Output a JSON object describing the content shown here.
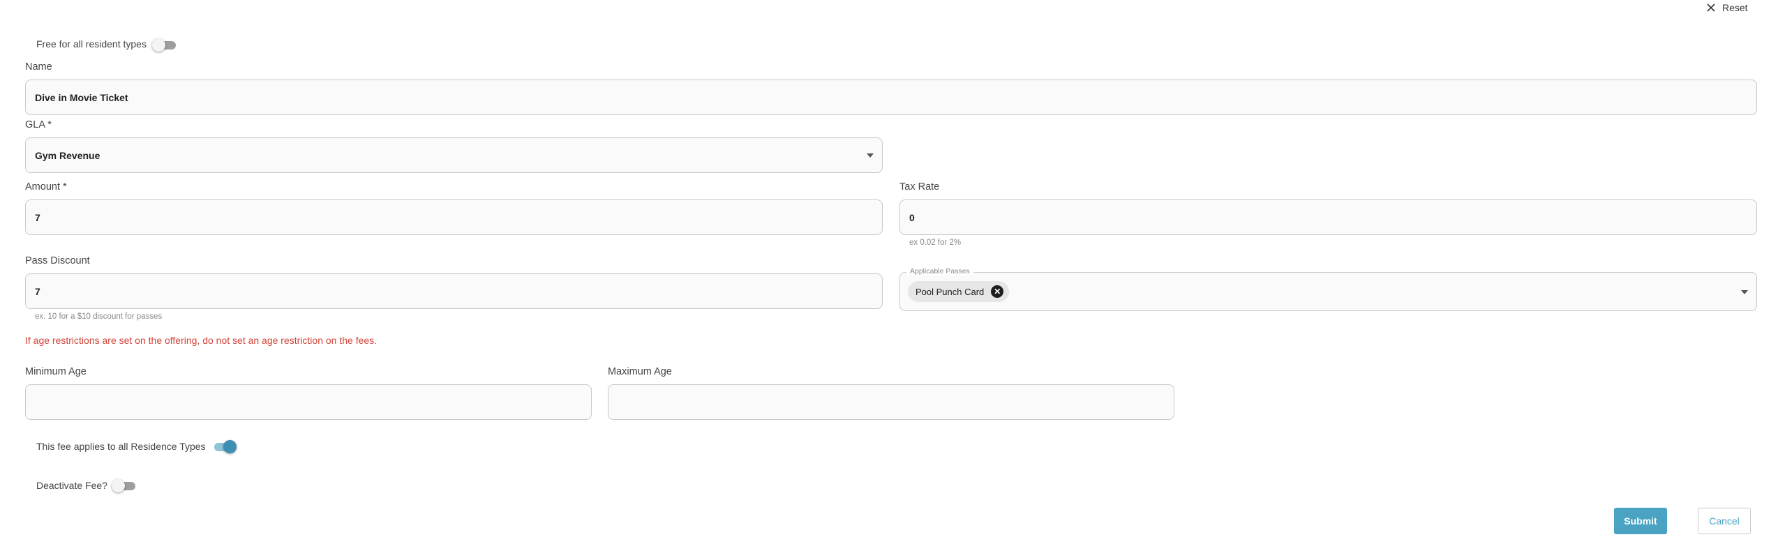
{
  "header": {
    "reset_label": "Reset"
  },
  "free_toggle": {
    "label": "Free for all resident types",
    "on": false
  },
  "name": {
    "label": "Name",
    "value": "Dive in Movie Ticket"
  },
  "gla": {
    "label": "GLA *",
    "value": "Gym Revenue"
  },
  "amount": {
    "label": "Amount *",
    "value": "7"
  },
  "tax_rate": {
    "label": "Tax Rate",
    "value": "0",
    "helper": "ex 0.02 for 2%"
  },
  "pass_discount": {
    "label": "Pass Discount",
    "value": "7",
    "helper": "ex. 10 for a $10 discount for passes"
  },
  "applicable_passes": {
    "label": "Applicable Passes",
    "chips": [
      "Pool Punch Card"
    ]
  },
  "age_warning": "If age restrictions are set on the offering, do not set an age restriction on the fees.",
  "min_age": {
    "label": "Minimum Age",
    "value": ""
  },
  "max_age": {
    "label": "Maximum Age",
    "value": ""
  },
  "residence_toggle": {
    "label": "This fee applies to all Residence Types",
    "on": true
  },
  "deactivate_toggle": {
    "label": "Deactivate Fee?",
    "on": false
  },
  "actions": {
    "submit_label": "Submit",
    "cancel_label": "Cancel"
  },
  "colors": {
    "accent": "#4aa3c2",
    "warning": "#d0453a"
  },
  "icons": {
    "reset": "close-icon",
    "dropdown": "caret-down-icon",
    "chip_remove": "cancel-circle-icon"
  }
}
